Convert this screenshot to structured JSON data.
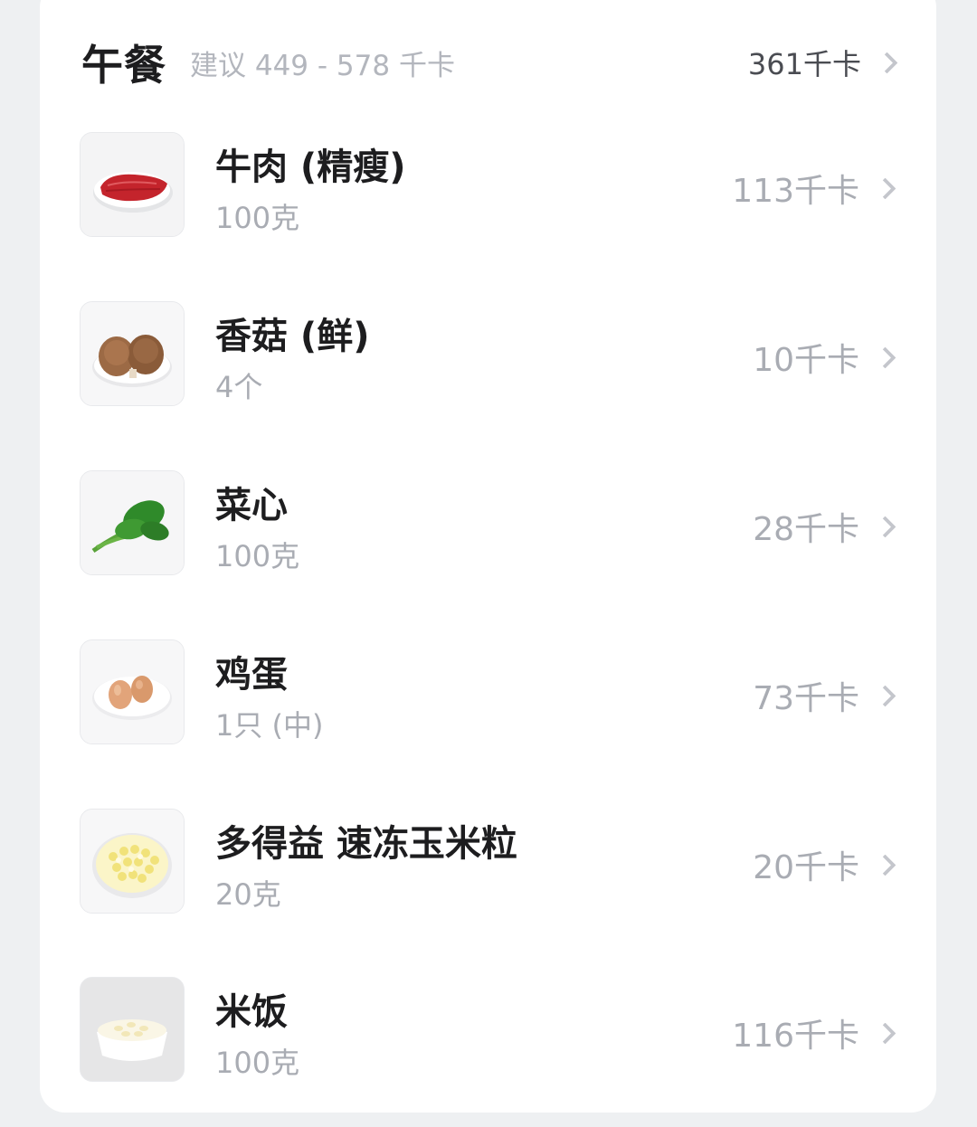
{
  "meal": {
    "title": "午餐",
    "hint": "建议 449 - 578 千卡",
    "total": "361千卡"
  },
  "items": [
    {
      "name": "牛肉 (精瘦)",
      "amount": "100克",
      "kcal": "113千卡",
      "icon": "beef-icon"
    },
    {
      "name": "香菇 (鲜)",
      "amount": "4个",
      "kcal": "10千卡",
      "icon": "mushroom-icon"
    },
    {
      "name": "菜心",
      "amount": "100克",
      "kcal": "28千卡",
      "icon": "choy-sum-icon"
    },
    {
      "name": "鸡蛋",
      "amount": "1只 (中)",
      "kcal": "73千卡",
      "icon": "egg-icon"
    },
    {
      "name": "多得益 速冻玉米粒",
      "amount": "20克",
      "kcal": "20千卡",
      "icon": "corn-icon"
    },
    {
      "name": "米饭",
      "amount": "100克",
      "kcal": "116千卡",
      "icon": "rice-icon"
    }
  ]
}
